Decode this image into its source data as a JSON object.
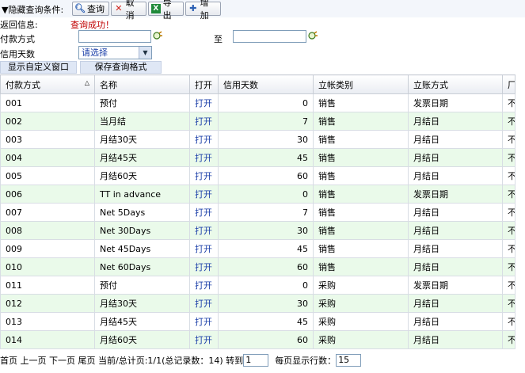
{
  "toolbar": {
    "toggle_label": "▼隐藏查询条件:",
    "buttons": {
      "query": "查询",
      "cancel": "取消",
      "export": "导出",
      "add": "增加"
    }
  },
  "result": {
    "label": "返回信息:",
    "message": "查询成功！"
  },
  "form": {
    "payment_method_label": "付款方式",
    "to_label": "至",
    "credit_days_label": "信用天数",
    "credit_days_value": "请选择"
  },
  "actions": {
    "show_custom_window": "显示自定义窗口",
    "save_query_format": "保存查询格式"
  },
  "table": {
    "headers": [
      "付款方式",
      "名称",
      "打开",
      "信用天数",
      "立帐类别",
      "立账方式",
      "厂"
    ],
    "rows": [
      {
        "code": "001",
        "name": "预付",
        "open": "打开",
        "days": "0",
        "category": "销售",
        "method": "发票日期",
        "extra": "不"
      },
      {
        "code": "002",
        "name": "当月结",
        "open": "打开",
        "days": "7",
        "category": "销售",
        "method": "月结日",
        "extra": "不"
      },
      {
        "code": "003",
        "name": "月结30天",
        "open": "打开",
        "days": "30",
        "category": "销售",
        "method": "月结日",
        "extra": "不"
      },
      {
        "code": "004",
        "name": "月结45天",
        "open": "打开",
        "days": "45",
        "category": "销售",
        "method": "月结日",
        "extra": "不"
      },
      {
        "code": "005",
        "name": "月结60天",
        "open": "打开",
        "days": "60",
        "category": "销售",
        "method": "月结日",
        "extra": "不"
      },
      {
        "code": "006",
        "name": "TT in advance",
        "open": "打开",
        "days": "0",
        "category": "销售",
        "method": "发票日期",
        "extra": "不"
      },
      {
        "code": "007",
        "name": "Net 5Days",
        "open": "打开",
        "days": "7",
        "category": "销售",
        "method": "月结日",
        "extra": "不"
      },
      {
        "code": "008",
        "name": "Net 30Days",
        "open": "打开",
        "days": "30",
        "category": "销售",
        "method": "月结日",
        "extra": "不"
      },
      {
        "code": "009",
        "name": "Net 45Days",
        "open": "打开",
        "days": "45",
        "category": "销售",
        "method": "月结日",
        "extra": "不"
      },
      {
        "code": "010",
        "name": "Net 60Days",
        "open": "打开",
        "days": "60",
        "category": "销售",
        "method": "月结日",
        "extra": "不"
      },
      {
        "code": "011",
        "name": "预付",
        "open": "打开",
        "days": "0",
        "category": "采购",
        "method": "发票日期",
        "extra": "不"
      },
      {
        "code": "012",
        "name": "月结30天",
        "open": "打开",
        "days": "30",
        "category": "采购",
        "method": "月结日",
        "extra": "不"
      },
      {
        "code": "013",
        "name": "月结45天",
        "open": "打开",
        "days": "45",
        "category": "采购",
        "method": "月结日",
        "extra": "不"
      },
      {
        "code": "014",
        "name": "月结60天",
        "open": "打开",
        "days": "60",
        "category": "采购",
        "method": "月结日",
        "extra": "不"
      }
    ]
  },
  "pager": {
    "nav_text": "首页 上一页 下一页 尾页 当前/总计页:1/1(总记录数：14) 转到",
    "goto_value": "1",
    "rows_label": "每页显示行数：",
    "rows_value": "15"
  },
  "colors": {
    "alt_row": "#eafaea",
    "link": "#1b3fa8",
    "message": "#c00000",
    "toolbar_bg": "#f3f6fb"
  }
}
